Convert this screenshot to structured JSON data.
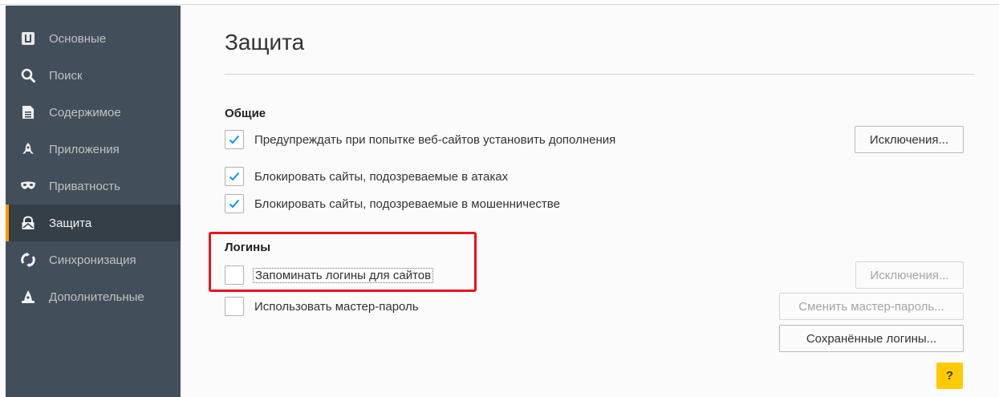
{
  "sidebar": {
    "items": [
      {
        "label": "Основные",
        "icon": "general-icon"
      },
      {
        "label": "Поиск",
        "icon": "search-icon"
      },
      {
        "label": "Содержимое",
        "icon": "content-icon"
      },
      {
        "label": "Приложения",
        "icon": "rocket-icon"
      },
      {
        "label": "Приватность",
        "icon": "mask-icon"
      },
      {
        "label": "Защита",
        "icon": "lock-icon",
        "active": true
      },
      {
        "label": "Синхронизация",
        "icon": "sync-icon"
      },
      {
        "label": "Дополнительные",
        "icon": "wizard-hat-icon"
      }
    ],
    "accent_color": "#ff9500"
  },
  "page": {
    "title": "Защита"
  },
  "general": {
    "heading": "Общие",
    "warn_addons": {
      "label": "Предупреждать при попытке веб-сайтов установить дополнения",
      "checked": true
    },
    "exceptions_button": "Исключения...",
    "block_attack": {
      "label": "Блокировать сайты, подозреваемые в атаках",
      "checked": true
    },
    "block_fraud": {
      "label": "Блокировать сайты, подозреваемые в мошенничестве",
      "checked": true
    }
  },
  "logins": {
    "heading": "Логины",
    "remember": {
      "label": "Запоминать логины для сайтов",
      "checked": false
    },
    "exceptions_button": "Исключения...",
    "master_password": {
      "label": "Использовать мастер-пароль",
      "checked": false
    },
    "change_master_button": "Сменить мастер-пароль...",
    "saved_logins_button": "Сохранённые логины..."
  },
  "help_button": "?",
  "highlight_color": "#e8141e",
  "help_color": "#ffcb00"
}
